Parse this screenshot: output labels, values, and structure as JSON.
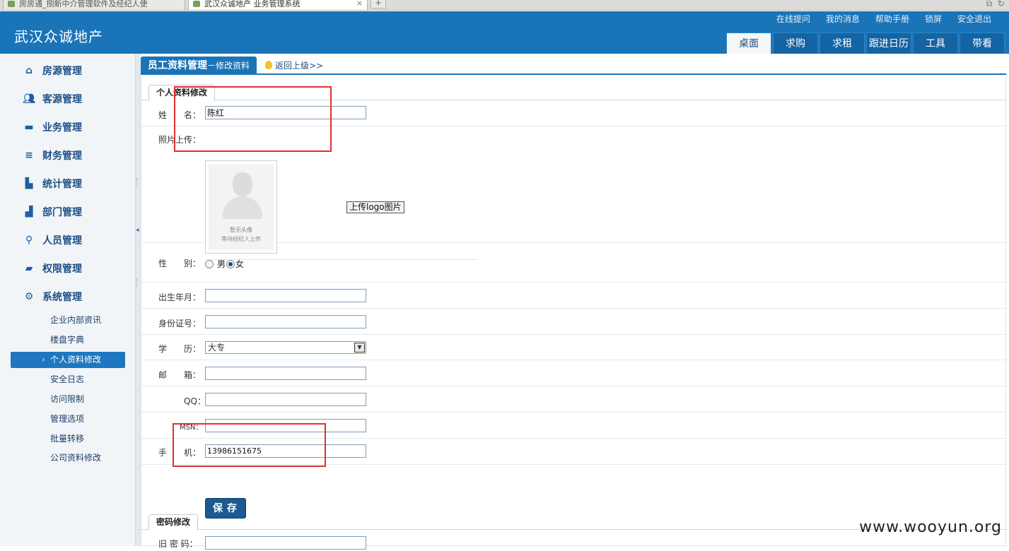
{
  "browser_tabs": [
    {
      "title": "房房通_捌新中介管理软件及经纪人使"
    },
    {
      "title": "武汉众诚地产 业务管理系统"
    }
  ],
  "header": {
    "brand": "武汉众诚地产",
    "top_links": [
      "在线提问",
      "我的消息",
      "帮助手册",
      "锁屏",
      "安全退出"
    ],
    "nav_tabs": [
      "桌面",
      "求购",
      "求租",
      "跟进日历",
      "工具",
      "带看"
    ],
    "active_tab": "桌面"
  },
  "sidebar": {
    "menu": [
      {
        "label": "房源管理",
        "icon": "home-icon"
      },
      {
        "label": "客源管理",
        "icon": "users-icon"
      },
      {
        "label": "业务管理",
        "icon": "car-icon"
      },
      {
        "label": "财务管理",
        "icon": "finance-icon"
      },
      {
        "label": "统计管理",
        "icon": "bar-chart-icon"
      },
      {
        "label": "部门管理",
        "icon": "org-chart-icon"
      },
      {
        "label": "人员管理",
        "icon": "paperclip-icon"
      },
      {
        "label": "权限管理",
        "icon": "chat-icon"
      },
      {
        "label": "系统管理",
        "icon": "gear-icon"
      }
    ],
    "submenu": [
      {
        "label": "企业内部资讯"
      },
      {
        "label": "楼盘字典"
      },
      {
        "label": "个人资料修改"
      },
      {
        "label": "安全日志"
      },
      {
        "label": "访问限制"
      },
      {
        "label": "管理选项"
      },
      {
        "label": "批量转移"
      },
      {
        "label": "公司资料修改"
      }
    ],
    "active_submenu": "个人资料修改"
  },
  "breadcrumb": {
    "title": "员工资料管理",
    "subtitle": "－修改资料",
    "back_link": "返回上级>>"
  },
  "profile_form": {
    "tab": "个人资料修改",
    "name_label": "姓　　名：",
    "name_value": "陈红",
    "photo_label": "照片上传：",
    "photo_caption_1": "暂无头像",
    "photo_caption_2": "等待经纪人上传",
    "upload_button": "上传logo图片",
    "gender_label": "性　　别：",
    "gender_male": "男",
    "gender_female": "女",
    "gender_selected": "女",
    "birth_label": "出生年月：",
    "birth_value": "",
    "id_label": "身份证号：",
    "id_value": "",
    "edu_label": "学　　历：",
    "edu_value": "大专",
    "email_label": "邮　　箱：",
    "email_value": "",
    "qq_label": "QQ：",
    "qq_value": "",
    "msn_label": "MSN：",
    "msn_value": "",
    "phone_label": "手　　机：",
    "phone_value": "13986151675",
    "save_button": "保存"
  },
  "password_form": {
    "tab": "密码修改",
    "old_label": "旧 密 码：",
    "old_value": ""
  },
  "watermark": "www.wooyun.org",
  "colors": {
    "header_blue": "#1a74b8",
    "annotation_red": "#e0302f",
    "active_item": "#1e77c0"
  }
}
